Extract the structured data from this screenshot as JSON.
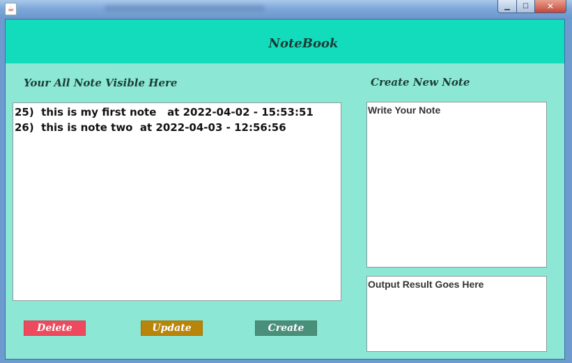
{
  "window": {
    "icon": "java-icon",
    "controls": {
      "minimize": "▁",
      "maximize": "☐",
      "close": "✕"
    }
  },
  "header": {
    "title": "NoteBook"
  },
  "labels": {
    "notes_section": "Your All Note Visible Here",
    "create_section": "Create New Note"
  },
  "notes": [
    "25)  this is my first note   at 2022-04-02 - 15:53:51",
    "26)  this is note two  at 2022-04-03 - 12:56:56"
  ],
  "note_input": {
    "value": "Write Your Note"
  },
  "output": {
    "value": "Output Result Goes Here"
  },
  "buttons": {
    "delete": "Delete",
    "update": "Update",
    "create": "Create"
  },
  "colors": {
    "header": "#13dcbd",
    "background": "#8ce8d4",
    "delete": "#ee4a5e",
    "update": "#b8840a",
    "create": "#4a8f7a"
  }
}
